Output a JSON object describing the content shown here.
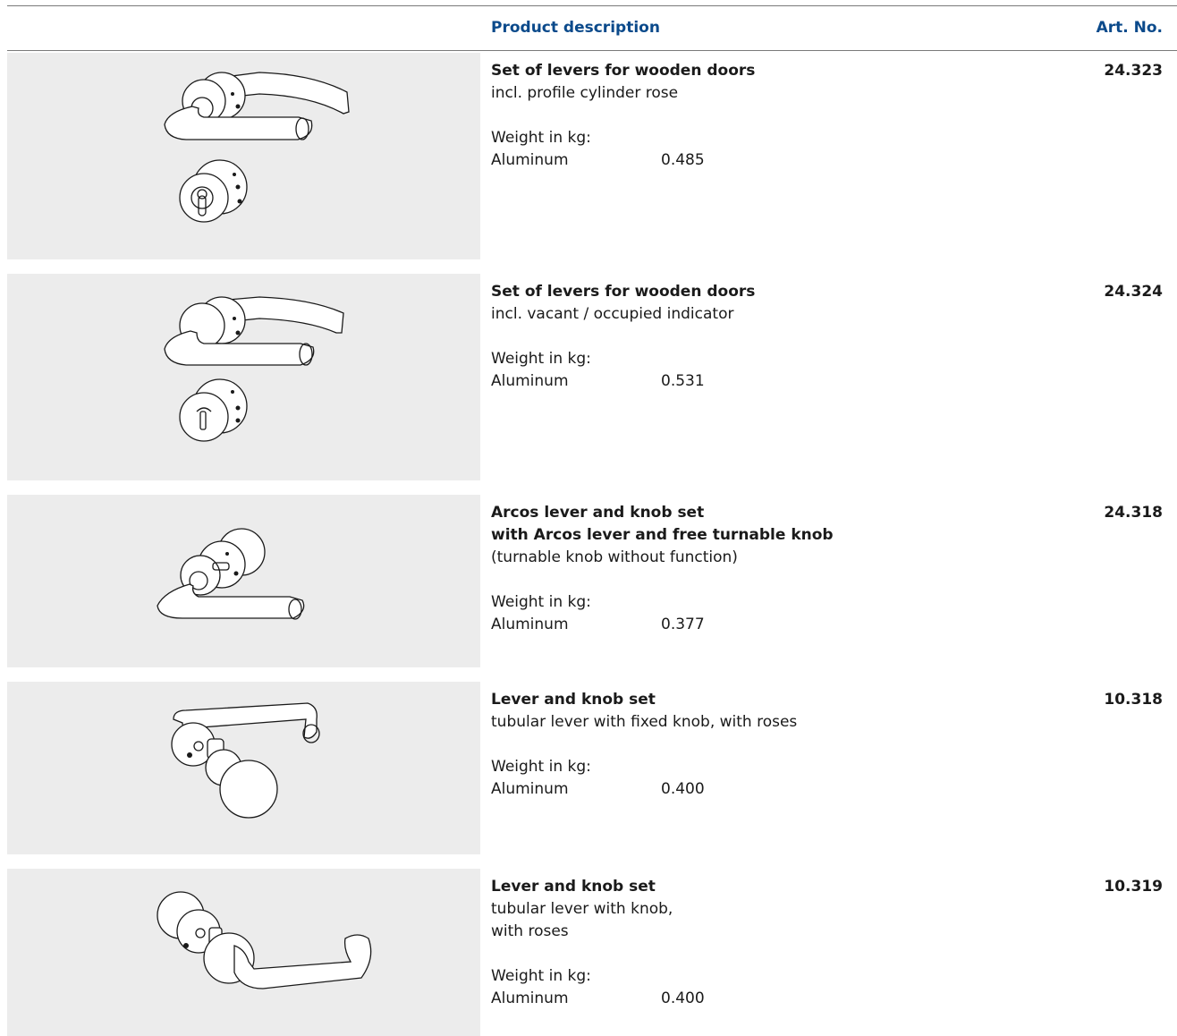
{
  "header": {
    "product_description": "Product description",
    "art_no": "Art. No."
  },
  "products": [
    {
      "title": "Set of levers for wooden doors",
      "subtitle_lines": [
        "incl. profile cylinder rose"
      ],
      "weight_label": "Weight in kg:",
      "material": "Aluminum",
      "weight": "0.485",
      "art_no": "24.323",
      "image": "lever-set-cylinder-rose-illustration"
    },
    {
      "title": "Set of levers for wooden doors",
      "subtitle_lines": [
        "incl. vacant / occupied indicator"
      ],
      "weight_label": "Weight in kg:",
      "material": "Aluminum",
      "weight": "0.531",
      "art_no": "24.324",
      "image": "lever-set-indicator-illustration"
    },
    {
      "title": "Arcos lever and knob set",
      "title2": "with Arcos lever and free turnable knob",
      "subtitle_lines": [
        "(turnable knob without function)"
      ],
      "weight_label": "Weight in kg:",
      "material": "Aluminum",
      "weight": "0.377",
      "art_no": "24.318",
      "image": "arcos-lever-knob-illustration"
    },
    {
      "title": "Lever and knob set",
      "subtitle_lines": [
        "tubular lever with fixed knob, with roses"
      ],
      "weight_label": "Weight in kg:",
      "material": "Aluminum",
      "weight": "0.400",
      "art_no": "10.318",
      "image": "lever-fixed-knob-illustration"
    },
    {
      "title": "Lever and knob set",
      "subtitle_lines": [
        "tubular lever with knob,",
        "with roses"
      ],
      "weight_label": "Weight in kg:",
      "material": "Aluminum",
      "weight": "0.400",
      "art_no": "10.319",
      "image": "lever-knob-illustration"
    }
  ]
}
